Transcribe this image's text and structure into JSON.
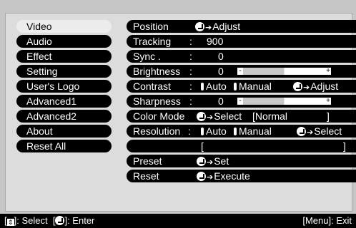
{
  "menu": {
    "items": [
      "Video",
      "Audio",
      "Effect",
      "Setting",
      "User's Logo",
      "Advanced1",
      "Advanced2",
      "About",
      "Reset All"
    ],
    "selected_index": 0
  },
  "panel": {
    "position": {
      "label": "Position",
      "action": "Adjust"
    },
    "tracking": {
      "label": "Tracking",
      "value": "900"
    },
    "sync": {
      "label": "Sync .",
      "value": "0"
    },
    "brightness": {
      "label": "Brightness",
      "value": "0",
      "level": 0.5
    },
    "contrast": {
      "label": "Contrast",
      "option_auto": "Auto",
      "option_manual": "Manual",
      "action": "Adjust"
    },
    "sharpness": {
      "label": "Sharpness",
      "value": "0",
      "level": 0.5
    },
    "color_mode": {
      "label": "Color Mode",
      "action": "Select",
      "value": "[Normal",
      "close": "]"
    },
    "resolution": {
      "label": "Resolution",
      "option_auto": "Auto",
      "option_manual": "Manual",
      "action": "Select",
      "value_open": "[",
      "value_close": "]"
    },
    "preset": {
      "label": "Preset",
      "action": "Set"
    },
    "reset": {
      "label": "Reset",
      "action": "Execute"
    }
  },
  "statusbar": {
    "select_hint": ": Select",
    "enter_hint": ": Enter",
    "exit_hint": "[Menu]: Exit"
  }
}
